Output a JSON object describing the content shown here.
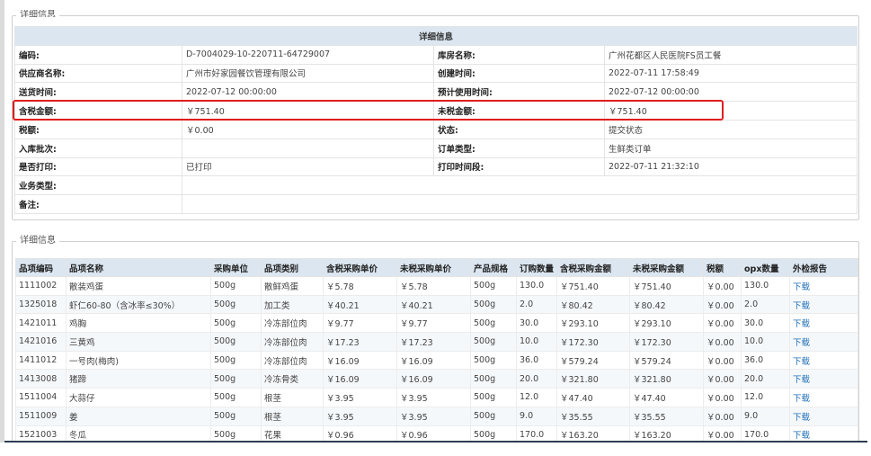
{
  "detail_section": {
    "legend": "详细信息",
    "header": "详细信息",
    "rows": [
      {
        "l1": "编码:",
        "v1": "D-7004029-10-220711-64729007",
        "l2": "库房名称:",
        "v2": "广州花都区人民医院FS员工餐"
      },
      {
        "l1": "供应商名称:",
        "v1": "广州市好家园餐饮管理有限公司",
        "l2": "创建时间:",
        "v2": "2022-07-11 17:58:49"
      },
      {
        "l1": "送货时间:",
        "v1": "2022-07-12 00:00:00",
        "l2": "预计使用时间:",
        "v2": "2022-07-12 00:00:00"
      },
      {
        "l1": "含税金额:",
        "v1": "￥751.40",
        "l2": "未税金额:",
        "v2": "￥751.40"
      },
      {
        "l1": "税额:",
        "v1": "￥0.00",
        "l2": "状态:",
        "v2": "提交状态"
      },
      {
        "l1": "入库批次:",
        "v1": "",
        "l2": "订单类型:",
        "v2": "生鲜类订单"
      },
      {
        "l1": "是否打印:",
        "v1": "已打印",
        "l2": "打印时间段:",
        "v2": "2022-07-11 21:32:10"
      }
    ],
    "business_type_label": "业务类型:",
    "remark_label": "备注:"
  },
  "items_section": {
    "legend": "详细信息",
    "columns": [
      "品项编码",
      "品项名称",
      "采购单位",
      "品项类别",
      "含税采购单价",
      "未税采购单价",
      "产品规格",
      "订购数量",
      "含税采购金额",
      "未税采购金额",
      "税额",
      "opx数量",
      "外检报告"
    ],
    "rows": [
      [
        "1111002",
        "散装鸡蛋",
        "500g",
        "散鲜鸡蛋",
        "￥5.78",
        "￥5.78",
        "500g",
        "130.0",
        "￥751.40",
        "￥751.40",
        "￥0.00",
        "130.0",
        "下载"
      ],
      [
        "1325018",
        "虾仁60-80（含冰率≤30%）",
        "500g",
        "加工类",
        "￥40.21",
        "￥40.21",
        "500g",
        "2.0",
        "￥80.42",
        "￥80.42",
        "￥0.00",
        "2.0",
        "下载"
      ],
      [
        "1421011",
        "鸡胸",
        "500g",
        "冷冻部位肉",
        "￥9.77",
        "￥9.77",
        "500g",
        "30.0",
        "￥293.10",
        "￥293.10",
        "￥0.00",
        "30.0",
        "下载"
      ],
      [
        "1421016",
        "三黄鸡",
        "500g",
        "冷冻部位肉",
        "￥17.23",
        "￥17.23",
        "500g",
        "10.0",
        "￥172.30",
        "￥172.30",
        "￥0.00",
        "10.0",
        "下载"
      ],
      [
        "1411012",
        "一号肉(梅肉)",
        "500g",
        "冷冻部位肉",
        "￥16.09",
        "￥16.09",
        "500g",
        "36.0",
        "￥579.24",
        "￥579.24",
        "￥0.00",
        "36.0",
        "下载"
      ],
      [
        "1413008",
        "猪蹄",
        "500g",
        "冷冻骨类",
        "￥16.09",
        "￥16.09",
        "500g",
        "20.0",
        "￥321.80",
        "￥321.80",
        "￥0.00",
        "20.0",
        "下载"
      ],
      [
        "1511004",
        "大蒜仔",
        "500g",
        "根茎",
        "￥3.95",
        "￥3.95",
        "500g",
        "12.0",
        "￥47.40",
        "￥47.40",
        "￥0.00",
        "12.0",
        "下载"
      ],
      [
        "1511009",
        "姜",
        "500g",
        "根茎",
        "￥3.95",
        "￥3.95",
        "500g",
        "9.0",
        "￥35.55",
        "￥35.55",
        "￥0.00",
        "9.0",
        "下载"
      ],
      [
        "1521003",
        "冬瓜",
        "500g",
        "花果",
        "￥0.96",
        "￥0.96",
        "500g",
        "170.0",
        "￥163.20",
        "￥163.20",
        "￥0.00",
        "170.0",
        "下载"
      ]
    ]
  },
  "colors": {
    "header_bg": "#dbe6f0",
    "highlight": "#e11d1d",
    "link": "#1f6fb8"
  }
}
